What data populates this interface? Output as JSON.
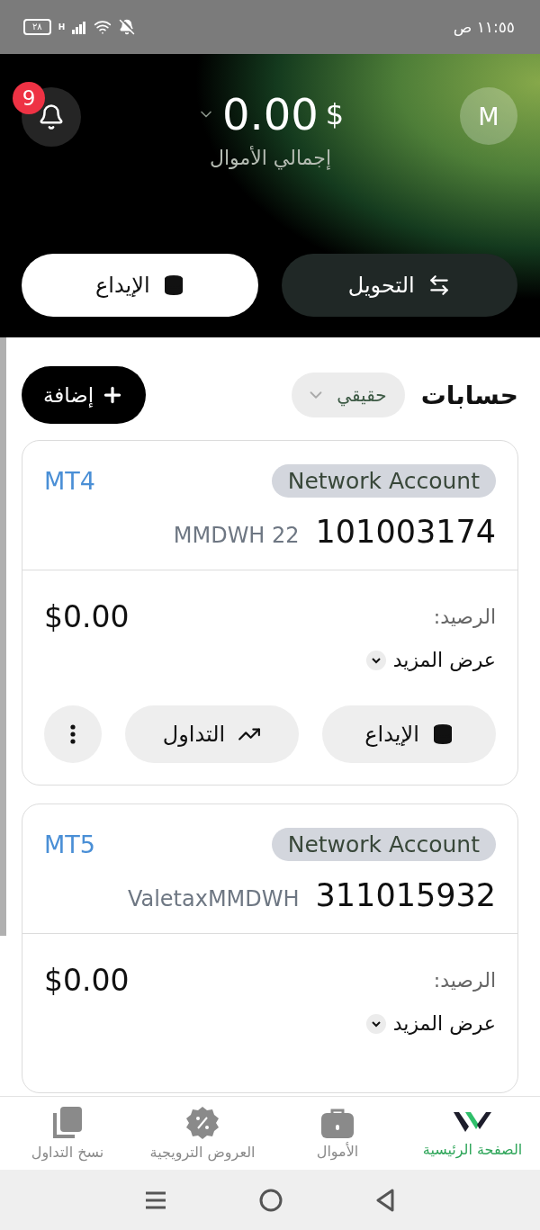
{
  "status_bar": {
    "time": "١١:٥٥ ص",
    "battery": "٢٨",
    "network": "H"
  },
  "header": {
    "notification_count": "9",
    "avatar": "M",
    "currency": "$",
    "total": "0.00",
    "total_label": "إجمالي الأموال",
    "buttons": [
      {
        "label": "التحويل",
        "kind": "transfer"
      },
      {
        "label": "الإيداع",
        "kind": "deposit"
      }
    ]
  },
  "accounts": {
    "title": "حسابات",
    "filter": "حقيقي",
    "add_button": "إضافة",
    "cards": [
      {
        "platform": "MT4",
        "type": "Network Account",
        "number": "101003174",
        "name": "MMDWH 22",
        "balance_label": "الرصيد:",
        "balance": "$0.00",
        "more": "عرض المزيد",
        "actions": [
          {
            "label": "الإيداع",
            "kind": "deposit"
          },
          {
            "label": "التداول",
            "kind": "trade"
          },
          {
            "kind": "more"
          }
        ]
      },
      {
        "platform": "MT5",
        "type": "Network Account",
        "number": "311015932",
        "name": "ValetaxMMDWH",
        "balance_label": "الرصيد:",
        "balance": "$0.00",
        "more": "عرض المزيد"
      }
    ]
  },
  "bottom_nav": [
    {
      "label": "الصفحة الرئيسية",
      "kind": "home",
      "selected": true
    },
    {
      "label": "الأموال",
      "kind": "funds",
      "selected": false
    },
    {
      "label": "العروض الترويجية",
      "kind": "promotions",
      "selected": false
    },
    {
      "label": "نسخ التداول",
      "kind": "copy",
      "selected": false
    }
  ]
}
